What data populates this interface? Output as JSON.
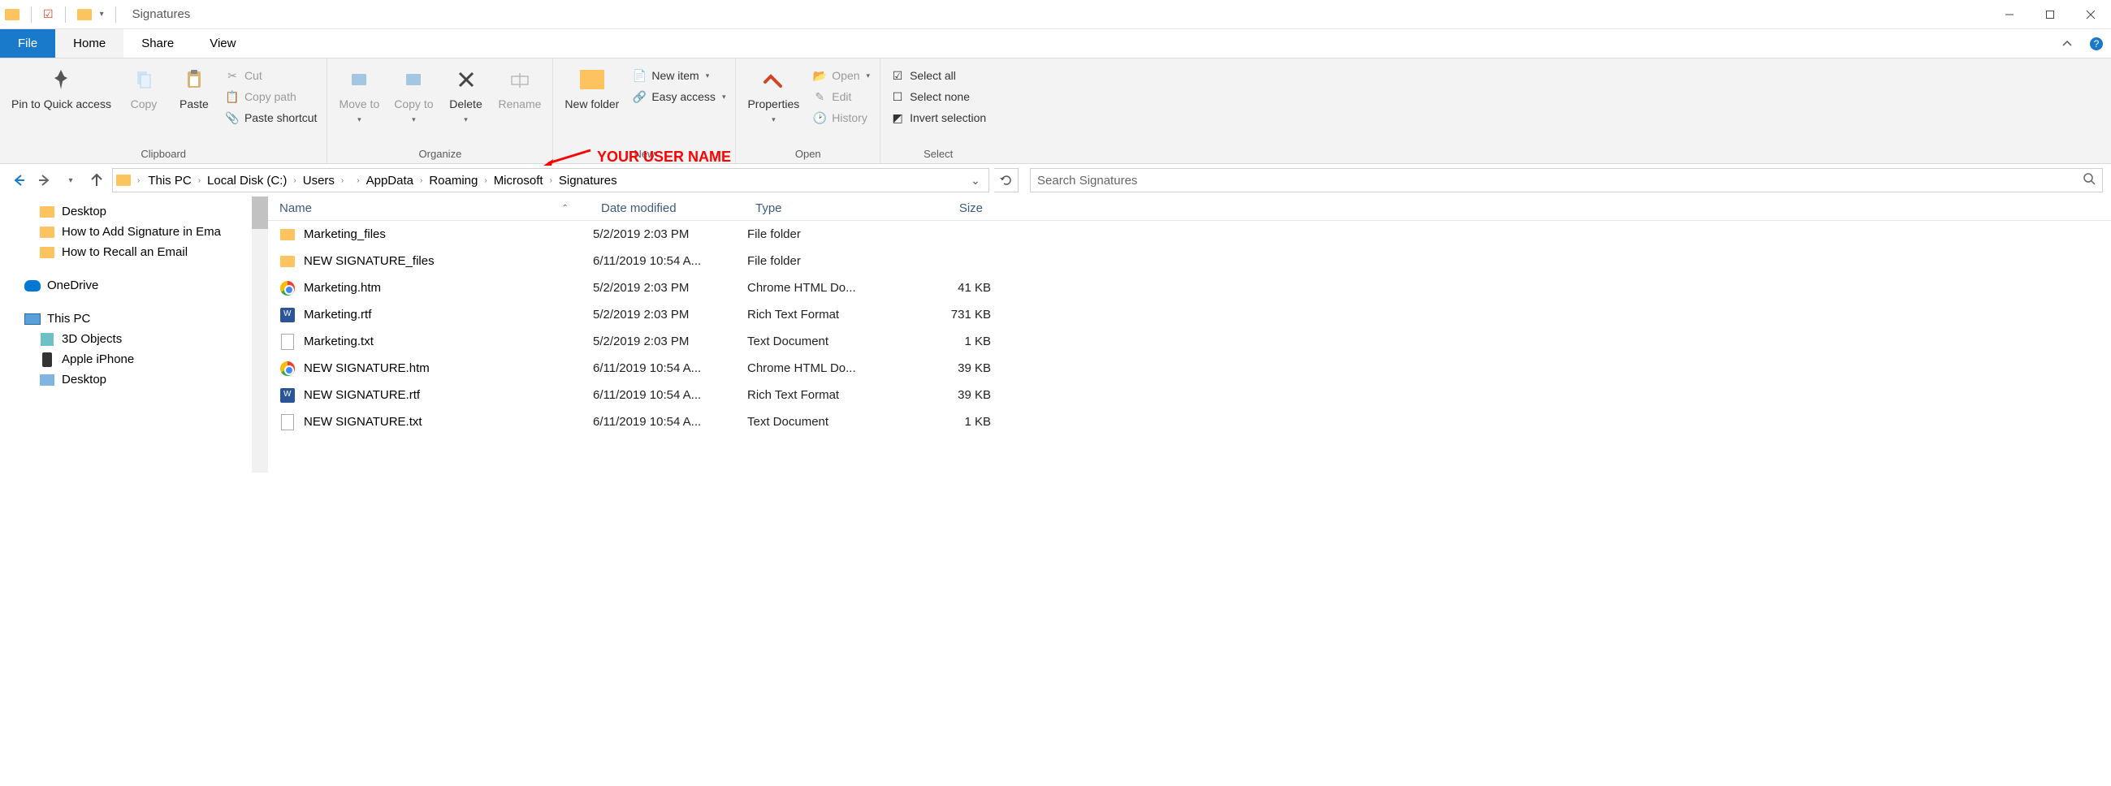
{
  "window_title": "Signatures",
  "tabs": {
    "file": "File",
    "home": "Home",
    "share": "Share",
    "view": "View"
  },
  "ribbon": {
    "clipboard": {
      "name": "Clipboard",
      "pin": "Pin to Quick access",
      "copy": "Copy",
      "paste": "Paste",
      "cut": "Cut",
      "copy_path": "Copy path",
      "paste_shortcut": "Paste shortcut"
    },
    "organize": {
      "name": "Organize",
      "move_to": "Move to",
      "copy_to": "Copy to",
      "delete": "Delete",
      "rename": "Rename"
    },
    "new": {
      "name": "New",
      "new_folder": "New folder",
      "new_item": "New item",
      "easy_access": "Easy access"
    },
    "open": {
      "name": "Open",
      "properties": "Properties",
      "open": "Open",
      "edit": "Edit",
      "history": "History"
    },
    "select": {
      "name": "Select",
      "select_all": "Select all",
      "select_none": "Select none",
      "invert": "Invert selection"
    }
  },
  "annotation": "YOUR USER NAME",
  "breadcrumb": [
    "This PC",
    "Local Disk (C:)",
    "Users",
    "",
    "AppData",
    "Roaming",
    "Microsoft",
    "Signatures"
  ],
  "search_placeholder": "Search Signatures",
  "sidebar": [
    {
      "label": "Desktop",
      "icon": "folder",
      "level": 1
    },
    {
      "label": "How to Add Signature in Ema",
      "icon": "folder",
      "level": 1
    },
    {
      "label": "How to Recall an Email",
      "icon": "folder",
      "level": 1
    },
    {
      "gap": true
    },
    {
      "label": "OneDrive",
      "icon": "onedrive",
      "level": 0
    },
    {
      "gap": true
    },
    {
      "label": "This PC",
      "icon": "thispc",
      "level": 0
    },
    {
      "label": "3D Objects",
      "icon": "3d",
      "level": 1
    },
    {
      "label": "Apple iPhone",
      "icon": "phone",
      "level": 1
    },
    {
      "label": "Desktop",
      "icon": "folder-blue",
      "level": 1
    }
  ],
  "columns": {
    "name": "Name",
    "date": "Date modified",
    "type": "Type",
    "size": "Size"
  },
  "files": [
    {
      "name": "Marketing_files",
      "date": "5/2/2019 2:03 PM",
      "type": "File folder",
      "size": "",
      "icon": "folder"
    },
    {
      "name": "NEW SIGNATURE_files",
      "date": "6/11/2019 10:54 A...",
      "type": "File folder",
      "size": "",
      "icon": "folder"
    },
    {
      "name": "Marketing.htm",
      "date": "5/2/2019 2:03 PM",
      "type": "Chrome HTML Do...",
      "size": "41 KB",
      "icon": "chrome"
    },
    {
      "name": "Marketing.rtf",
      "date": "5/2/2019 2:03 PM",
      "type": "Rich Text Format",
      "size": "731 KB",
      "icon": "rtf"
    },
    {
      "name": "Marketing.txt",
      "date": "5/2/2019 2:03 PM",
      "type": "Text Document",
      "size": "1 KB",
      "icon": "txt"
    },
    {
      "name": "NEW SIGNATURE.htm",
      "date": "6/11/2019 10:54 A...",
      "type": "Chrome HTML Do...",
      "size": "39 KB",
      "icon": "chrome"
    },
    {
      "name": "NEW SIGNATURE.rtf",
      "date": "6/11/2019 10:54 A...",
      "type": "Rich Text Format",
      "size": "39 KB",
      "icon": "rtf"
    },
    {
      "name": "NEW SIGNATURE.txt",
      "date": "6/11/2019 10:54 A...",
      "type": "Text Document",
      "size": "1 KB",
      "icon": "txt"
    }
  ]
}
